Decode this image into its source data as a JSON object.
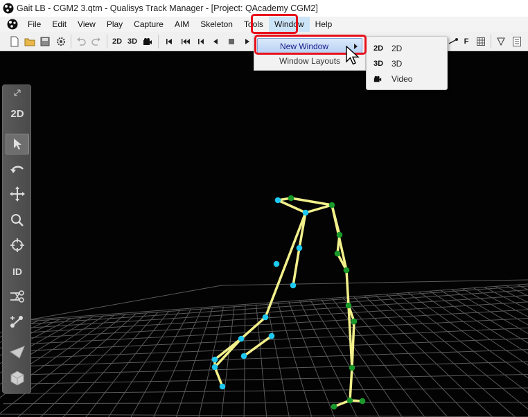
{
  "window": {
    "title": "Gait LB - CGM2 3.qtm - Qualisys Track Manager - [Project: QAcademy CGM2]"
  },
  "menubar": {
    "items": [
      "File",
      "Edit",
      "View",
      "Play",
      "Capture",
      "AIM",
      "Skeleton",
      "Tools",
      "Window",
      "Help"
    ],
    "active": "Window"
  },
  "toolbar": {
    "label_2d": "2D",
    "label_3d": "3D",
    "label_f": "F"
  },
  "window_menu": {
    "items": [
      {
        "label": "New Window",
        "has_submenu": true,
        "highlighted": true
      },
      {
        "label": "Window Layouts",
        "has_submenu": false,
        "highlighted": false
      }
    ]
  },
  "new_window_submenu": {
    "items": [
      {
        "icon": "2D",
        "label": "2D"
      },
      {
        "icon": "3D",
        "label": "3D"
      },
      {
        "icon": "video-camera-icon",
        "label": "Video"
      }
    ]
  },
  "tool_palette": {
    "label_2d": "2D",
    "label_id": "ID",
    "selected_tool": "select-arrow"
  },
  "colors": {
    "viewport_bg": "#030303",
    "grid_line": "#5a5a5a",
    "bone": "#f2f08a",
    "marker_blue": "#1ec8f0",
    "marker_green": "#1a9a2a",
    "annotation_red": "#e8101b",
    "menu_highlight": "#cce4f7"
  }
}
